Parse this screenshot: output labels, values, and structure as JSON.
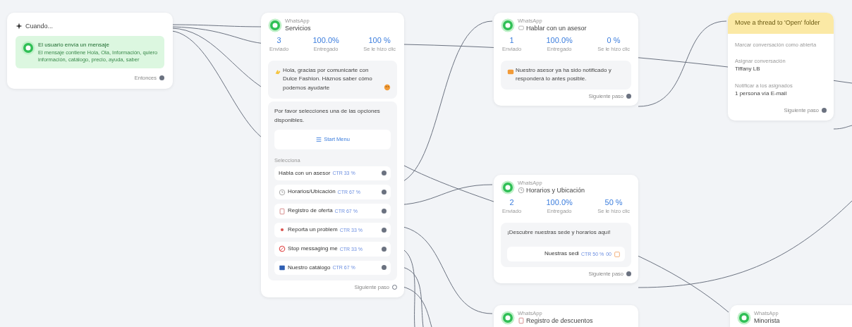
{
  "canvas": {
    "nodes": [
      {
        "kind": "trigger",
        "title": "Cuando...",
        "event": {
          "title": "El usuario envía un mensaje",
          "description": "El mensaje contiene Hola, Ola, Información, quiero información, catálogo, precio, ayuda, saber"
        },
        "next_label": "Entonces",
        "next_connected": true
      },
      {
        "kind": "whatsapp",
        "channel": "WhatsApp",
        "title": "Servicios",
        "stats": [
          {
            "value": "3",
            "label": "Enviado"
          },
          {
            "value": "100.0%",
            "label": "Entregado"
          },
          {
            "value": "100 %",
            "label": "Se le hizo clic"
          }
        ],
        "messages": [
          {
            "kind": "text",
            "text": "Hola, gracias por comunicarte con Dulce Fashion. Háznos saber cómo podemos ayudarte"
          },
          {
            "kind": "menu",
            "text": "Por favor selecciones una de las opciones disponibles.",
            "button": "Start Menu",
            "section": "Selecciona",
            "options": [
              {
                "kind": "plain",
                "label": "Habla con un asesor",
                "ctr": "CTR 33 %"
              },
              {
                "kind": "clock",
                "label": "Horarios/Ubicación",
                "ctr": "CTR 67 %"
              },
              {
                "kind": "document",
                "label": "Registro de oferta",
                "ctr": "CTR 67 %"
              },
              {
                "kind": "alert",
                "label": "Reporta un problem",
                "ctr": "CTR 33 %"
              },
              {
                "kind": "stop",
                "label": "Stop messaging me",
                "ctr": "CTR 33 %"
              },
              {
                "kind": "catalog",
                "label": "Nuestro catálogo",
                "ctr": "CTR 67 %"
              }
            ]
          }
        ],
        "next_label": "Siguiente paso",
        "next_connected": false
      },
      {
        "kind": "whatsapp",
        "channel": "WhatsApp",
        "title": "Hablar con un asesor",
        "stats": [
          {
            "value": "1",
            "label": "Enviado"
          },
          {
            "value": "100.0%",
            "label": "Entregado"
          },
          {
            "value": "0 %",
            "label": "Se le hizo clic"
          }
        ],
        "messages": [
          {
            "kind": "text",
            "text": "Nuestro asesor ya ha sido notificado y responderá lo antes posible."
          }
        ],
        "next_label": "Siguiente paso",
        "next_connected": true
      },
      {
        "kind": "whatsapp",
        "channel": "WhatsApp",
        "title": "Horarios y Ubicación",
        "stats": [
          {
            "value": "2",
            "label": "Enviado"
          },
          {
            "value": "100.0%",
            "label": "Entregado"
          },
          {
            "value": "50 %",
            "label": "Se le hizo clic"
          }
        ],
        "messages": [
          {
            "kind": "links",
            "text": "¡Descubre nuestras sede y horarios aquí!",
            "options": [
              {
                "kind": "link",
                "label": "Nuestras sedi",
                "ctr": "CTR 50 %",
                "count": "00"
              }
            ]
          }
        ],
        "next_label": "Siguiente paso",
        "next_connected": true
      },
      {
        "kind": "whatsapp",
        "channel": "WhatsApp",
        "title": "Registro de descuentos"
      },
      {
        "kind": "action",
        "title": "Move a thread to 'Open' folder",
        "fields": [
          {
            "label": "Marcar conversación como abierta"
          },
          {
            "label": "Asignar conversación",
            "value": "Tiffany LB"
          },
          {
            "label": "Notificar a los asignados",
            "value": "1 persona vía E-mail"
          }
        ],
        "next_label": "Siguiente paso",
        "next_connected": true
      },
      {
        "kind": "whatsapp",
        "channel": "WhatsApp",
        "title": "Minorista"
      }
    ]
  }
}
